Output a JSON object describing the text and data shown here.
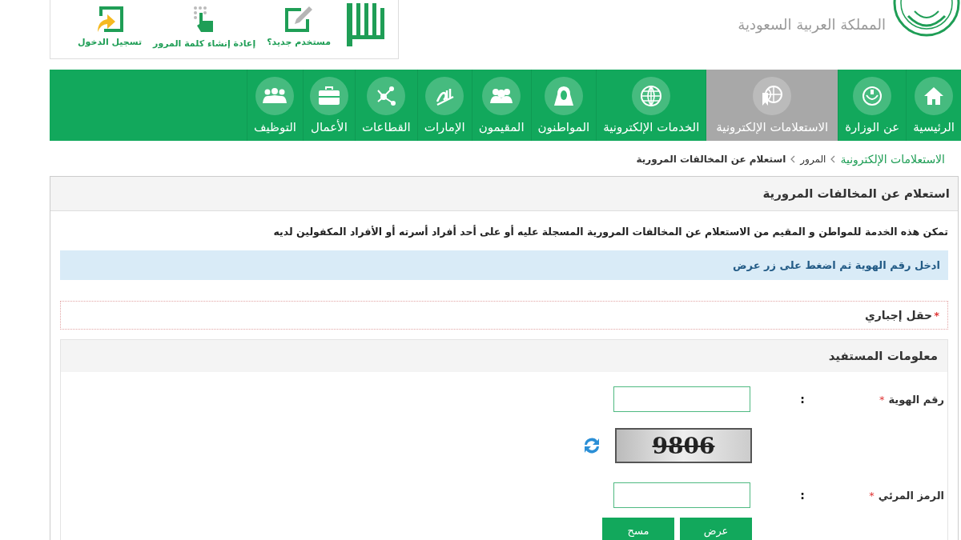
{
  "logo": {
    "subtitle": "المملكة العربية السعودية"
  },
  "account_links": [
    {
      "label": "مستخدم جديد؟"
    },
    {
      "label": "إعادة إنشاء كلمة المرور"
    },
    {
      "label": "تسجيل الدخول"
    }
  ],
  "nav": [
    {
      "label": "الرئيسية",
      "selected": false
    },
    {
      "label": "عن الوزارة",
      "selected": false
    },
    {
      "label": "الاستعلامات الإلكترونية",
      "selected": true
    },
    {
      "label": "الخدمات الإلكترونية",
      "selected": false
    },
    {
      "label": "المواطنون",
      "selected": false
    },
    {
      "label": "المقيمون",
      "selected": false
    },
    {
      "label": "الإمارات",
      "selected": false
    },
    {
      "label": "القطاعات",
      "selected": false
    },
    {
      "label": "الأعمال",
      "selected": false
    },
    {
      "label": "التوظيف",
      "selected": false
    }
  ],
  "breadcrumb": [
    {
      "label": "الاستعلامات الإلكترونية",
      "kind": "link"
    },
    {
      "label": "المرور",
      "kind": "link"
    },
    {
      "label": "استعلام عن المخالفات المرورية",
      "kind": "current"
    }
  ],
  "panel": {
    "title": "استعلام عن المخالفات المرورية",
    "description": "تمكن هذه الخدمة للمواطن و المقيم من الاستعلام عن المخالفات المرورية المسجلة عليه أو على أحد أفراد أسرته أو الأفراد المكفولين لديه",
    "info": "ادخل رقم الهوية ثم اضغط على زر عرض",
    "required_note": {
      "marker": "*",
      "text": "حقل إجباري"
    },
    "section_title": "معلومات المستفيد",
    "fields": [
      {
        "label": "رقم الهوية",
        "marker": "*",
        "separator": ":",
        "kind": "input"
      },
      {
        "kind": "captcha",
        "captcha": "9806"
      },
      {
        "label": "الرمز المرئي",
        "marker": "*",
        "separator": ":",
        "kind": "input"
      }
    ],
    "buttons": [
      "عرض",
      "مسح"
    ]
  }
}
